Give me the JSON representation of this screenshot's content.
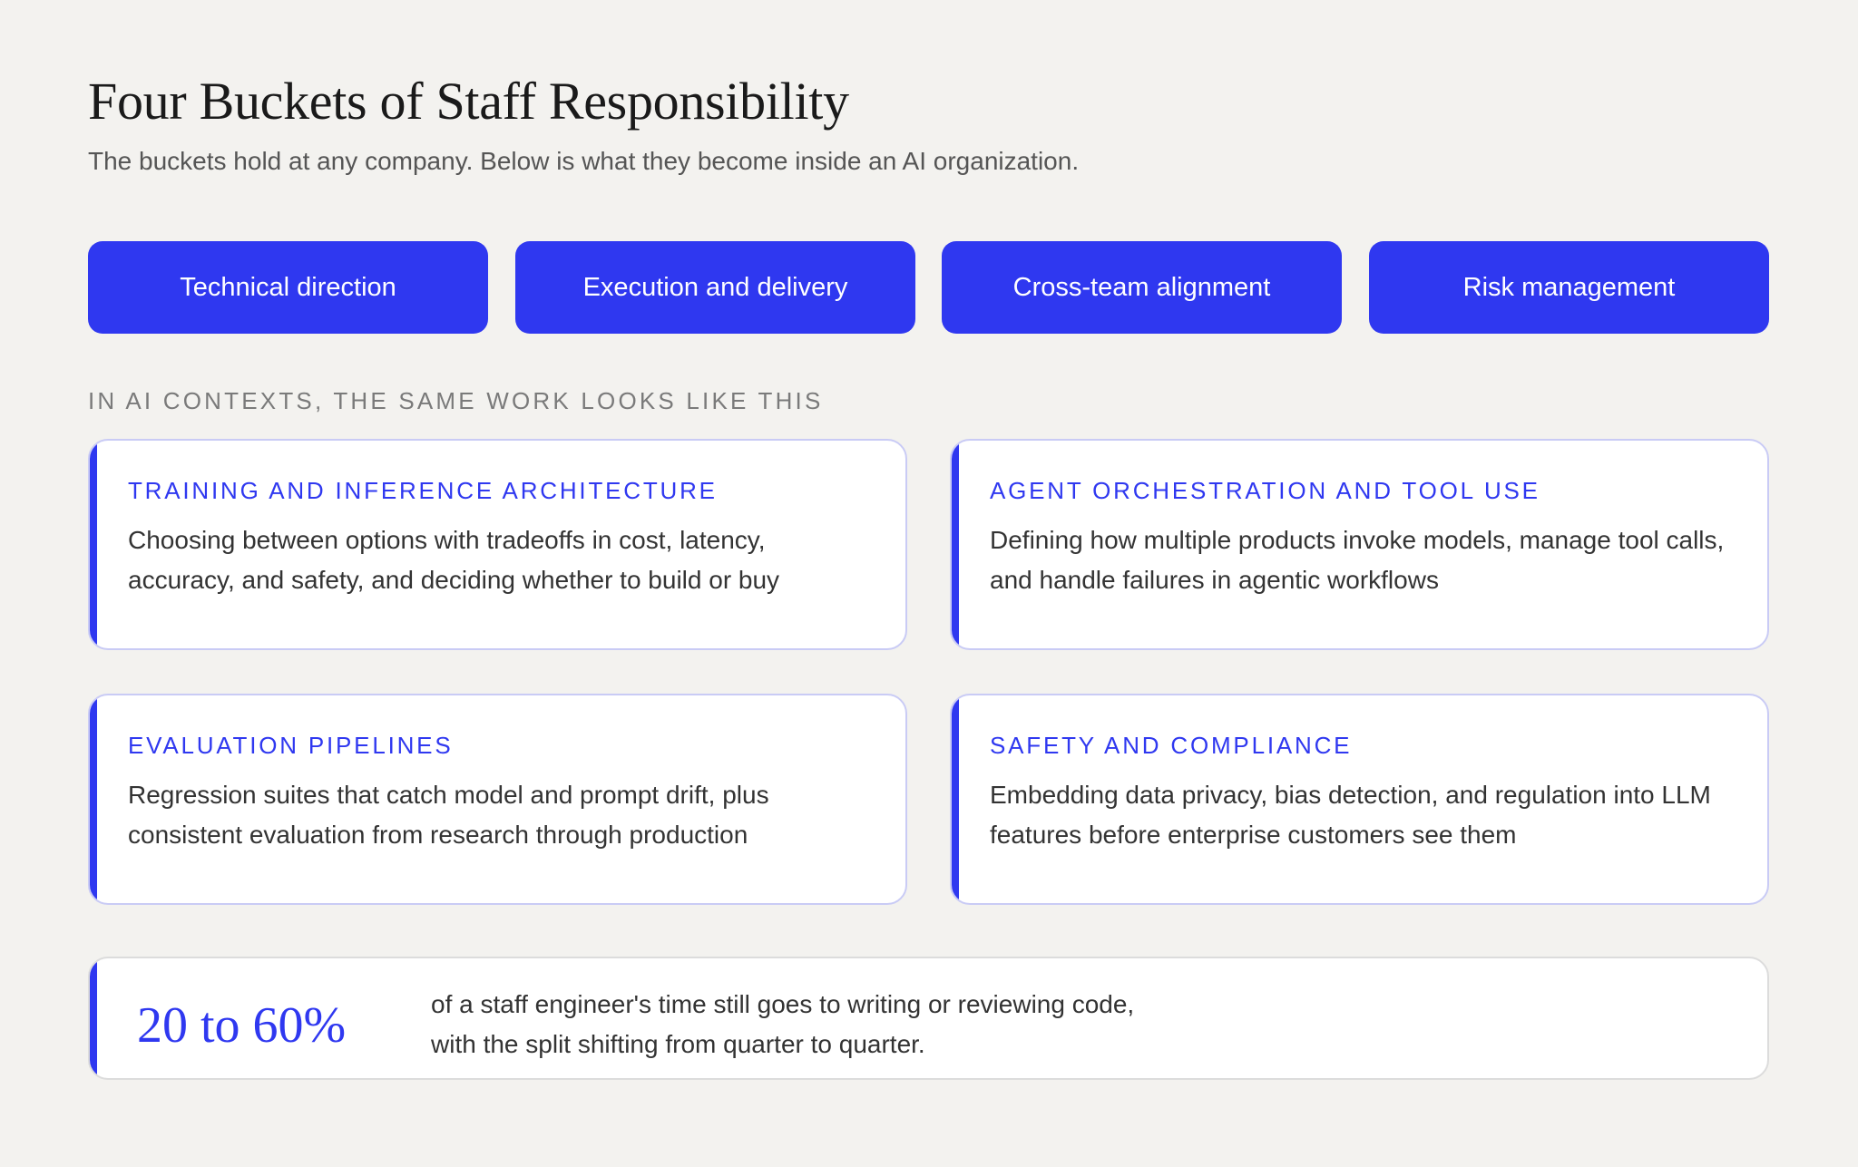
{
  "header": {
    "title": "Four Buckets of Staff Responsibility",
    "subtitle": "The buckets hold at any company. Below is what they become inside an AI organization."
  },
  "buckets": [
    {
      "label": "Technical direction"
    },
    {
      "label": "Execution and delivery"
    },
    {
      "label": "Cross-team alignment"
    },
    {
      "label": "Risk management"
    }
  ],
  "section_label": "IN AI CONTEXTS, THE SAME WORK LOOKS LIKE THIS",
  "cards": [
    {
      "title": "TRAINING AND INFERENCE ARCHITECTURE",
      "body": "Choosing between options with tradeoffs in cost, latency, accuracy, and safety, and deciding whether to build or buy"
    },
    {
      "title": "AGENT ORCHESTRATION AND TOOL USE",
      "body": "Defining how multiple products invoke models, manage tool calls, and handle failures in agentic workflows"
    },
    {
      "title": "EVALUATION PIPELINES",
      "body": "Regression suites that catch model and prompt drift, plus consistent evaluation from research through production"
    },
    {
      "title": "SAFETY AND COMPLIANCE",
      "body": "Embedding data privacy, bias detection, and regulation into LLM features before enterprise customers see them"
    }
  ],
  "stat": {
    "value": "20 to 60%",
    "text_line1": "of a staff engineer's time still goes to writing or reviewing code,",
    "text_line2": "with the split shifting from quarter to quarter."
  },
  "colors": {
    "accent": "#2f38f0",
    "background": "#f3f2ef",
    "card_border": "#c9cbf5"
  }
}
